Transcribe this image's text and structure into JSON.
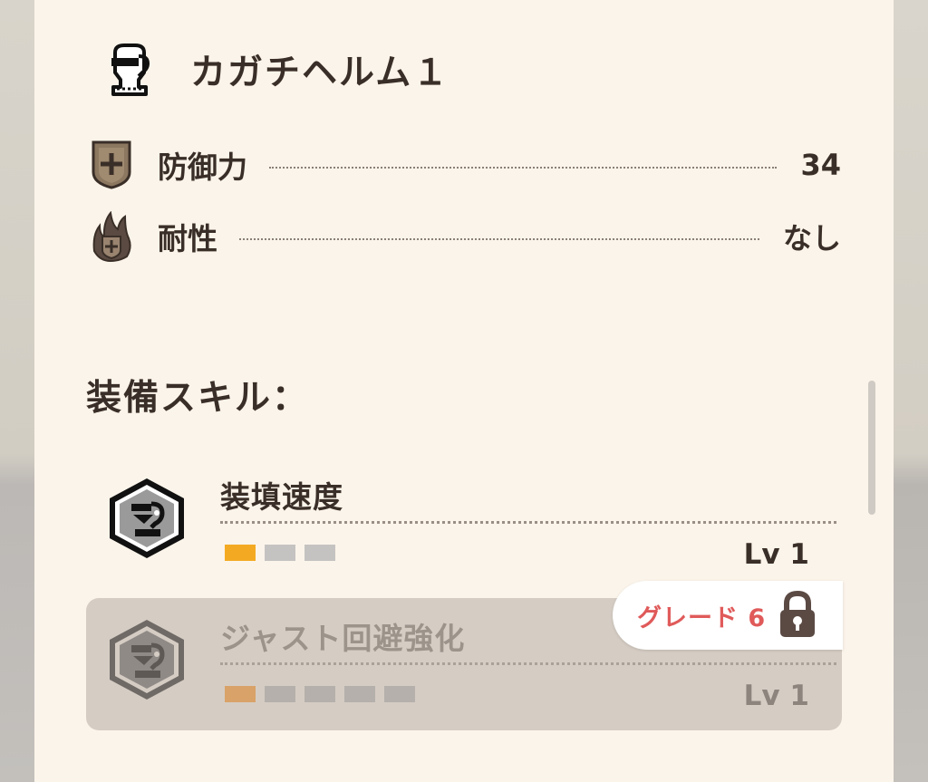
{
  "armor": {
    "name": "カガチヘルム１",
    "icon": "helmet-icon"
  },
  "stats": [
    {
      "label": "防御力",
      "value": "34",
      "icon": "defense-shield-icon"
    },
    {
      "label": "耐性",
      "value": "なし",
      "icon": "resistance-flame-icon"
    }
  ],
  "skills_section": {
    "title": "装備スキル："
  },
  "skills": [
    {
      "name": "装填速度",
      "level_label": "Lv 1",
      "level_filled": 1,
      "level_max": 3,
      "icon": "gunner-skill-badge-icon",
      "locked": false
    },
    {
      "name": "ジャスト回避強化",
      "level_label": "Lv 1",
      "level_filled": 1,
      "level_max": 5,
      "icon": "gunner-skill-badge-icon",
      "locked": true,
      "lock_grade_label": "グレード 6"
    }
  ],
  "colors": {
    "panel_bg": "#fbf4ea",
    "text": "#3a2f28",
    "level_on": "#f3aa22",
    "level_off": "#c5c3c1",
    "grade_text": "#e05a5a",
    "locked_bg": "#d5cdc4"
  }
}
